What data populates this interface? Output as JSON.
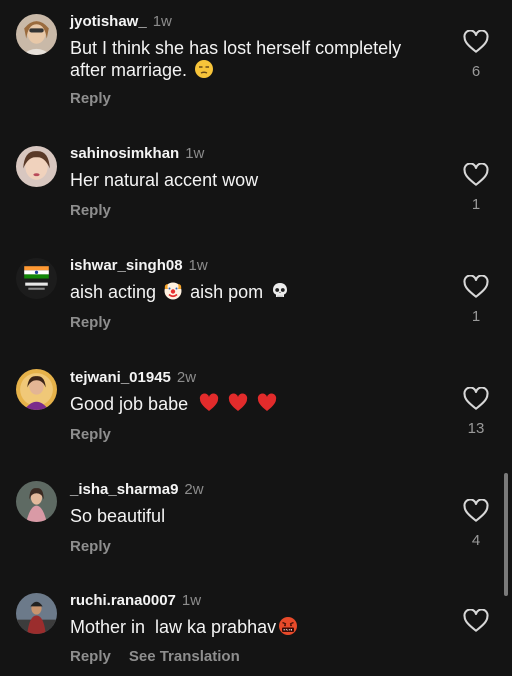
{
  "comments": [
    {
      "username": "jyotishaw_",
      "age": "1w",
      "text_lines": [
        "But I think she has lost herself completely",
        "after marriage."
      ],
      "trailing_emoji": "unamused-face",
      "reply_label": "Reply",
      "likes": "6"
    },
    {
      "username": "sahinosimkhan",
      "age": "1w",
      "text": "Her natural accent wow",
      "reply_label": "Reply",
      "likes": "1"
    },
    {
      "username": "ishwar_singh08",
      "age": "1w",
      "text_part1": "aish acting",
      "emoji1": "clown-face",
      "text_part2": "aish pom",
      "emoji2": "skull",
      "reply_label": "Reply",
      "likes": "1"
    },
    {
      "username": "tejwani_01945",
      "age": "2w",
      "text": "Good job babe",
      "emojis": [
        "red-heart",
        "red-heart",
        "red-heart"
      ],
      "reply_label": "Reply",
      "likes": "13"
    },
    {
      "username": "_isha_sharma9",
      "age": "2w",
      "text": "So beautiful",
      "reply_label": "Reply",
      "likes": "4"
    },
    {
      "username": "ruchi.rana0007",
      "age": "1w",
      "text": "Mother in  law ka prabhav",
      "trailing_emoji": "face-with-symbols-on-mouth",
      "reply_label": "Reply",
      "see_translation_label": "See Translation"
    }
  ],
  "colors": {
    "background": "#141414",
    "heart_red": "#e53535",
    "muted": "#8e8e8e"
  }
}
